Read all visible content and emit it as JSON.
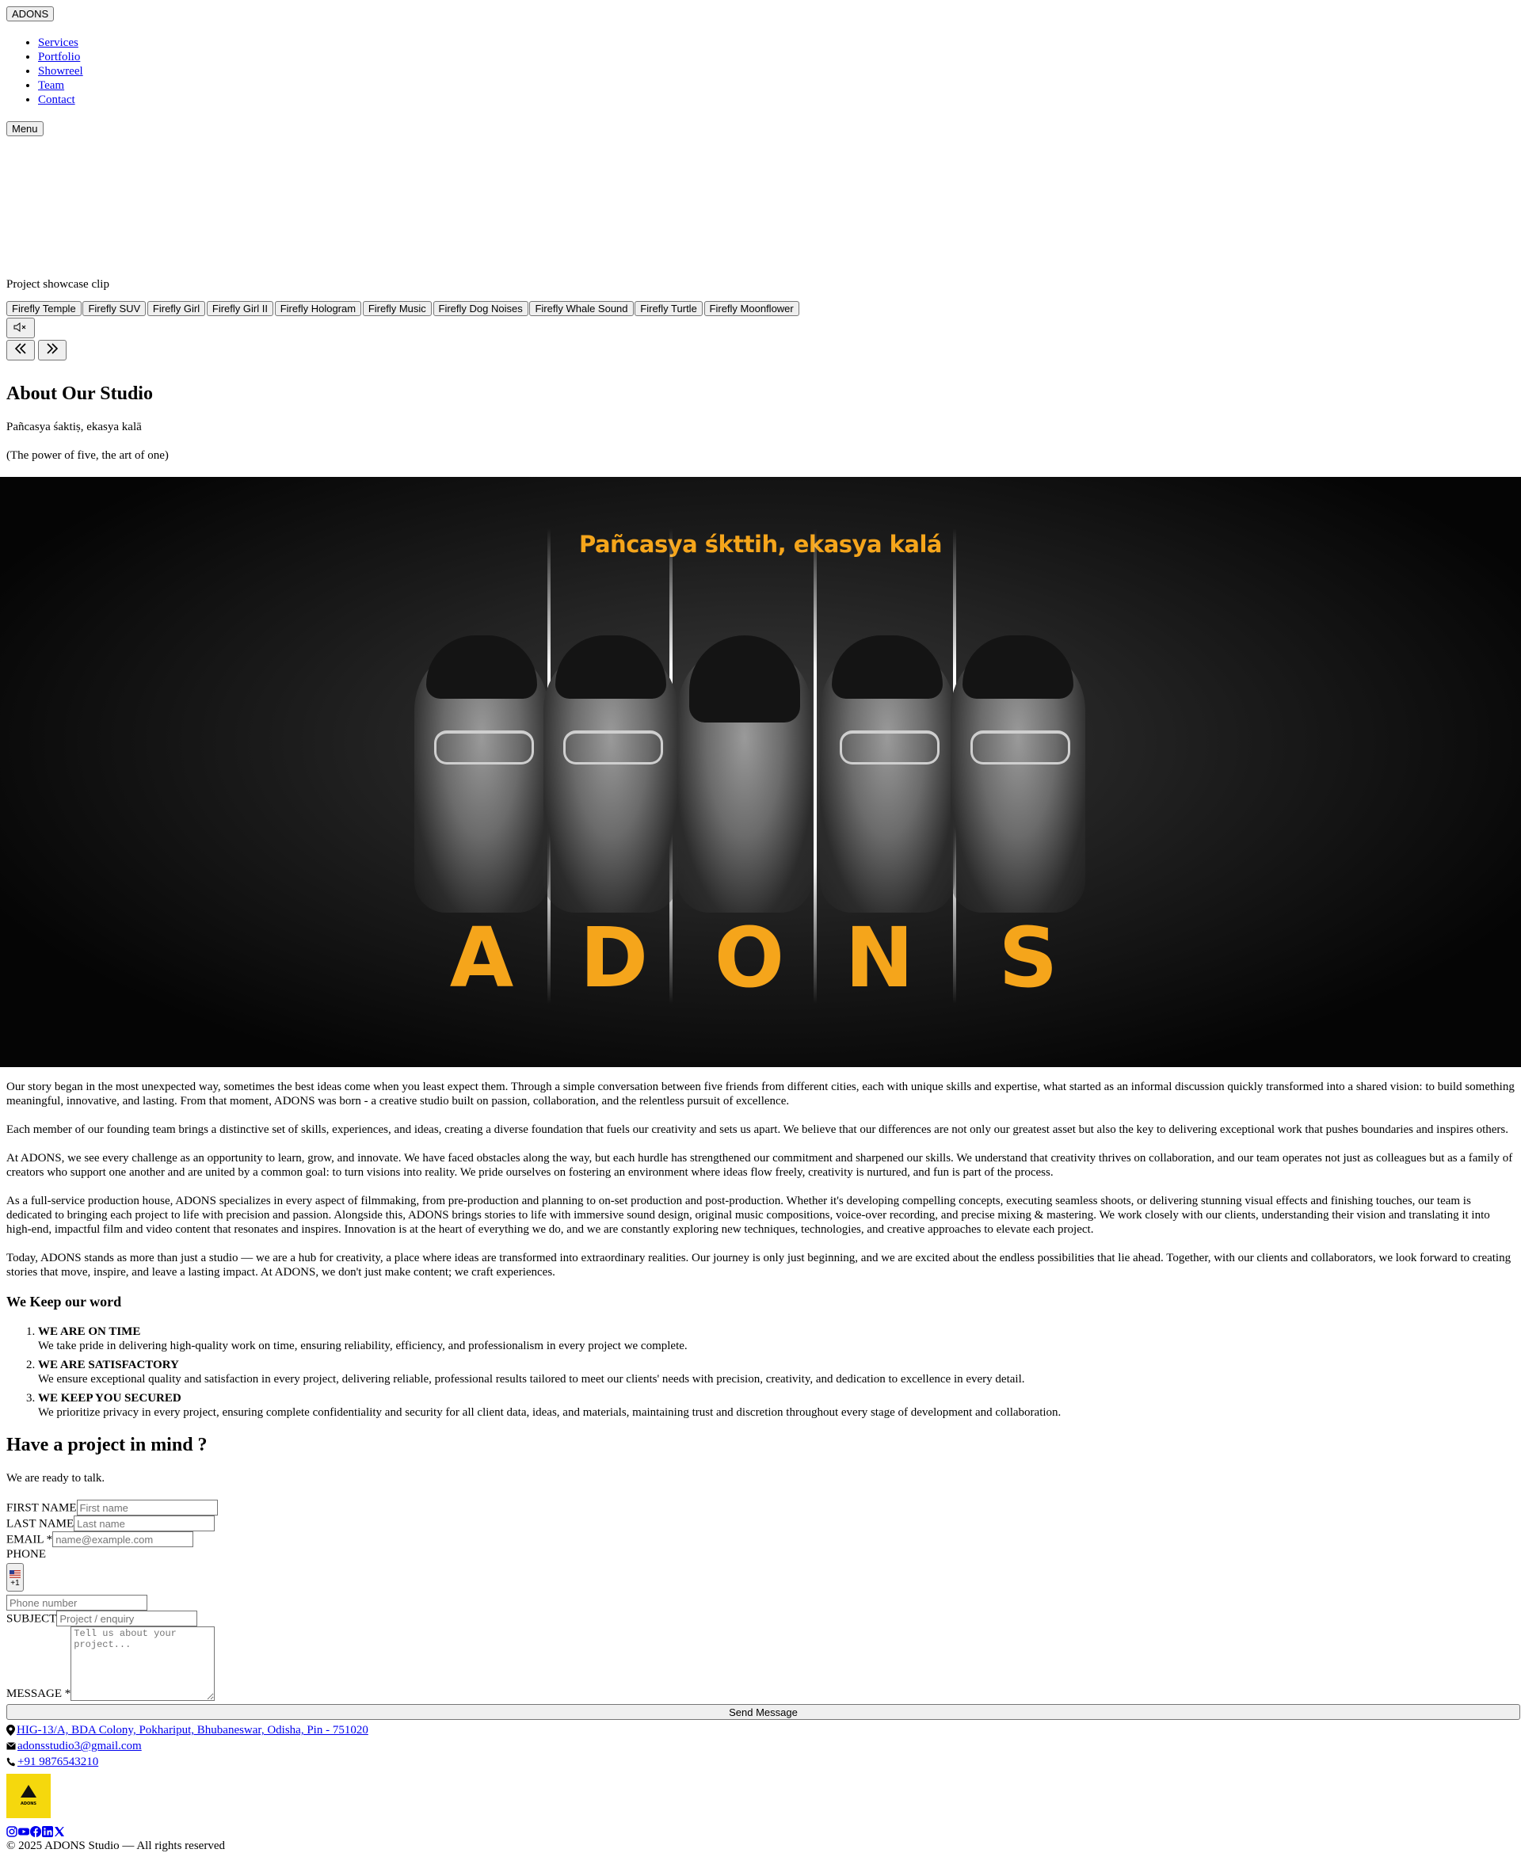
{
  "header": {
    "logo_label": "ADONS",
    "nav_items": [
      "Services",
      "Portfolio",
      "Showreel",
      "Team",
      "Contact"
    ],
    "menu_label": "Menu"
  },
  "hero": {
    "caption": "Project showcase clip",
    "clips": [
      "Firefly Temple",
      "Firefly SUV",
      "Firefly Girl",
      "Firefly Girl II",
      "Firefly Hologram",
      "Firefly Music",
      "Firefly Dog Noises",
      "Firefly Whale Sound",
      "Firefly Turtle",
      "Firefly Moonflower"
    ],
    "mute_icon": "speaker-muted-icon",
    "prev_icon": "double-chevron-left-icon",
    "next_icon": "double-chevron-right-icon"
  },
  "about": {
    "title": "About Our Studio",
    "motto": "Pañcasya śaktiṣ, ekasya kalā",
    "motto_translation": "(The power of five, the art of one)",
    "banner_tagline": "Pañcasya śkttih, ekasya kalá",
    "banner_letters": [
      "A",
      "D",
      "O",
      "N",
      "S"
    ],
    "paragraphs": [
      "Our story began in the most unexpected way, sometimes the best ideas come when you least expect them. Through a simple conversation between five friends from different cities, each with unique skills and expertise, what started as an informal discussion quickly transformed into a shared vision: to build something meaningful, innovative, and lasting. From that moment, ADONS was born - a creative studio built on passion, collaboration, and the relentless pursuit of excellence.",
      "Each member of our founding team brings a distinctive set of skills, experiences, and ideas, creating a diverse foundation that fuels our creativity and sets us apart. We believe that our differences are not only our greatest asset but also the key to delivering exceptional work that pushes boundaries and inspires others.",
      "At ADONS, we see every challenge as an opportunity to learn, grow, and innovate. We have faced obstacles along the way, but each hurdle has strengthened our commitment and sharpened our skills. We understand that creativity thrives on collaboration, and our team operates not just as colleagues but as a family of creators who support one another and are united by a common goal: to turn visions into reality. We pride ourselves on fostering an environment where ideas flow freely, creativity is nurtured, and fun is part of the process.",
      "As a full-service production house, ADONS specializes in every aspect of filmmaking, from pre-production and planning to on-set production and post-production. Whether it's developing compelling concepts, executing seamless shoots, or delivering stunning visual effects and finishing touches, our team is dedicated to bringing each project to life with precision and passion. Alongside this, ADONS brings stories to life with immersive sound design, original music compositions, voice-over recording, and precise mixing & mastering. We work closely with our clients, understanding their vision and translating it into high-end, impactful film and video content that resonates and inspires. Innovation is at the heart of everything we do, and we are constantly exploring new techniques, technologies, and creative approaches to elevate each project.",
      "Today, ADONS stands as more than just a studio — we are a hub for creativity, a place where ideas are transformed into extraordinary realities. Our journey is only just beginning, and we are excited about the endless possibilities that lie ahead. Together, with our clients and collaborators, we look forward to creating stories that move, inspire, and leave a lasting impact. At ADONS, we don't just make content; we craft experiences."
    ]
  },
  "keep_word": {
    "title": "We Keep our word",
    "items": [
      {
        "title": "WE ARE ON TIME",
        "text": "We take pride in delivering high-quality work on time, ensuring reliability, efficiency, and professionalism in every project we complete."
      },
      {
        "title": "WE ARE SATISFACTORY",
        "text": "We ensure exceptional quality and satisfaction in every project, delivering reliable, professional results tailored to meet our clients' needs with precision, creativity, and dedication to excellence in every detail."
      },
      {
        "title": "WE KEEP YOU SECURED",
        "text": "We prioritize privacy in every project, ensuring complete confidentiality and security for all client data, ideas, and materials, maintaining trust and discretion throughout every stage of development and collaboration."
      }
    ]
  },
  "contact": {
    "title": "Have a project in mind ?",
    "subtitle": "We are ready to talk.",
    "first_name_label": "FIRST NAME",
    "first_name_placeholder": "First name",
    "last_name_label": "LAST NAME",
    "last_name_placeholder": "Last name",
    "email_label": "EMAIL *",
    "email_placeholder": "name@example.com",
    "phone_label": "PHONE",
    "country_code": "+1",
    "phone_placeholder": "Phone number",
    "subject_label": "SUBJECT",
    "subject_placeholder": "Project / enquiry",
    "message_label": "MESSAGE *",
    "message_placeholder": "Tell us about your project...",
    "send_label": "Send Message"
  },
  "footer": {
    "address": "HIG-13/A, BDA Colony, Pokhariput, Bhubaneswar, Odisha, Pin - 751020",
    "email": "adonsstudio3@gmail.com",
    "phone": "+91 9876543210",
    "logo_text": "ADONS",
    "socials": [
      "instagram-icon",
      "youtube-icon",
      "facebook-icon",
      "linkedin-icon",
      "x-icon"
    ],
    "copyright": "© 2025 ADONS Studio — All rights reserved"
  }
}
